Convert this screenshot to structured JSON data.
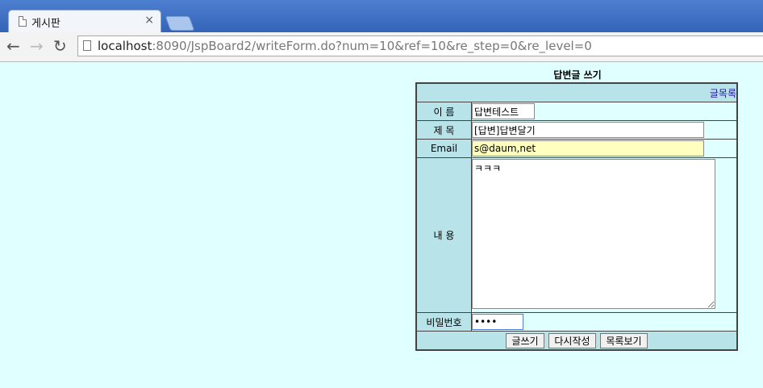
{
  "browser": {
    "tab_title": "게시판",
    "tab_close": "×",
    "url_host": "localhost",
    "url_rest": ":8090/JspBoard2/writeForm.do?num=10&ref=10&re_step=0&re_level=0"
  },
  "form": {
    "heading": "답변글 쓰기",
    "list_link": "글목록",
    "labels": {
      "name": "이 름",
      "subject": "제 목",
      "email": "Email",
      "content": "내 용",
      "password": "비밀번호"
    },
    "values": {
      "name": "답변테스트",
      "subject": "[답변]답변달기",
      "email": "s@daum,net",
      "content": "ㅋㅋㅋ",
      "password": "••••"
    },
    "buttons": {
      "submit": "글쓰기",
      "reset": "다시작성",
      "list": "목록보기"
    }
  }
}
